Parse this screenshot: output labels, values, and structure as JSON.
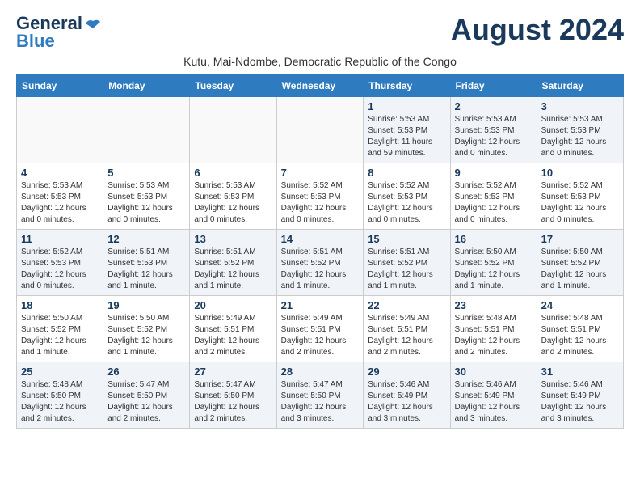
{
  "header": {
    "logo_line1": "General",
    "logo_line2": "Blue",
    "month_title": "August 2024",
    "subtitle": "Kutu, Mai-Ndombe, Democratic Republic of the Congo"
  },
  "weekdays": [
    "Sunday",
    "Monday",
    "Tuesday",
    "Wednesday",
    "Thursday",
    "Friday",
    "Saturday"
  ],
  "weeks": [
    [
      {
        "day": "",
        "info": ""
      },
      {
        "day": "",
        "info": ""
      },
      {
        "day": "",
        "info": ""
      },
      {
        "day": "",
        "info": ""
      },
      {
        "day": "1",
        "info": "Sunrise: 5:53 AM\nSunset: 5:53 PM\nDaylight: 11 hours\nand 59 minutes."
      },
      {
        "day": "2",
        "info": "Sunrise: 5:53 AM\nSunset: 5:53 PM\nDaylight: 12 hours\nand 0 minutes."
      },
      {
        "day": "3",
        "info": "Sunrise: 5:53 AM\nSunset: 5:53 PM\nDaylight: 12 hours\nand 0 minutes."
      }
    ],
    [
      {
        "day": "4",
        "info": "Sunrise: 5:53 AM\nSunset: 5:53 PM\nDaylight: 12 hours\nand 0 minutes."
      },
      {
        "day": "5",
        "info": "Sunrise: 5:53 AM\nSunset: 5:53 PM\nDaylight: 12 hours\nand 0 minutes."
      },
      {
        "day": "6",
        "info": "Sunrise: 5:53 AM\nSunset: 5:53 PM\nDaylight: 12 hours\nand 0 minutes."
      },
      {
        "day": "7",
        "info": "Sunrise: 5:52 AM\nSunset: 5:53 PM\nDaylight: 12 hours\nand 0 minutes."
      },
      {
        "day": "8",
        "info": "Sunrise: 5:52 AM\nSunset: 5:53 PM\nDaylight: 12 hours\nand 0 minutes."
      },
      {
        "day": "9",
        "info": "Sunrise: 5:52 AM\nSunset: 5:53 PM\nDaylight: 12 hours\nand 0 minutes."
      },
      {
        "day": "10",
        "info": "Sunrise: 5:52 AM\nSunset: 5:53 PM\nDaylight: 12 hours\nand 0 minutes."
      }
    ],
    [
      {
        "day": "11",
        "info": "Sunrise: 5:52 AM\nSunset: 5:53 PM\nDaylight: 12 hours\nand 0 minutes."
      },
      {
        "day": "12",
        "info": "Sunrise: 5:51 AM\nSunset: 5:53 PM\nDaylight: 12 hours\nand 1 minute."
      },
      {
        "day": "13",
        "info": "Sunrise: 5:51 AM\nSunset: 5:52 PM\nDaylight: 12 hours\nand 1 minute."
      },
      {
        "day": "14",
        "info": "Sunrise: 5:51 AM\nSunset: 5:52 PM\nDaylight: 12 hours\nand 1 minute."
      },
      {
        "day": "15",
        "info": "Sunrise: 5:51 AM\nSunset: 5:52 PM\nDaylight: 12 hours\nand 1 minute."
      },
      {
        "day": "16",
        "info": "Sunrise: 5:50 AM\nSunset: 5:52 PM\nDaylight: 12 hours\nand 1 minute."
      },
      {
        "day": "17",
        "info": "Sunrise: 5:50 AM\nSunset: 5:52 PM\nDaylight: 12 hours\nand 1 minute."
      }
    ],
    [
      {
        "day": "18",
        "info": "Sunrise: 5:50 AM\nSunset: 5:52 PM\nDaylight: 12 hours\nand 1 minute."
      },
      {
        "day": "19",
        "info": "Sunrise: 5:50 AM\nSunset: 5:52 PM\nDaylight: 12 hours\nand 1 minute."
      },
      {
        "day": "20",
        "info": "Sunrise: 5:49 AM\nSunset: 5:51 PM\nDaylight: 12 hours\nand 2 minutes."
      },
      {
        "day": "21",
        "info": "Sunrise: 5:49 AM\nSunset: 5:51 PM\nDaylight: 12 hours\nand 2 minutes."
      },
      {
        "day": "22",
        "info": "Sunrise: 5:49 AM\nSunset: 5:51 PM\nDaylight: 12 hours\nand 2 minutes."
      },
      {
        "day": "23",
        "info": "Sunrise: 5:48 AM\nSunset: 5:51 PM\nDaylight: 12 hours\nand 2 minutes."
      },
      {
        "day": "24",
        "info": "Sunrise: 5:48 AM\nSunset: 5:51 PM\nDaylight: 12 hours\nand 2 minutes."
      }
    ],
    [
      {
        "day": "25",
        "info": "Sunrise: 5:48 AM\nSunset: 5:50 PM\nDaylight: 12 hours\nand 2 minutes."
      },
      {
        "day": "26",
        "info": "Sunrise: 5:47 AM\nSunset: 5:50 PM\nDaylight: 12 hours\nand 2 minutes."
      },
      {
        "day": "27",
        "info": "Sunrise: 5:47 AM\nSunset: 5:50 PM\nDaylight: 12 hours\nand 2 minutes."
      },
      {
        "day": "28",
        "info": "Sunrise: 5:47 AM\nSunset: 5:50 PM\nDaylight: 12 hours\nand 3 minutes."
      },
      {
        "day": "29",
        "info": "Sunrise: 5:46 AM\nSunset: 5:49 PM\nDaylight: 12 hours\nand 3 minutes."
      },
      {
        "day": "30",
        "info": "Sunrise: 5:46 AM\nSunset: 5:49 PM\nDaylight: 12 hours\nand 3 minutes."
      },
      {
        "day": "31",
        "info": "Sunrise: 5:46 AM\nSunset: 5:49 PM\nDaylight: 12 hours\nand 3 minutes."
      }
    ]
  ]
}
